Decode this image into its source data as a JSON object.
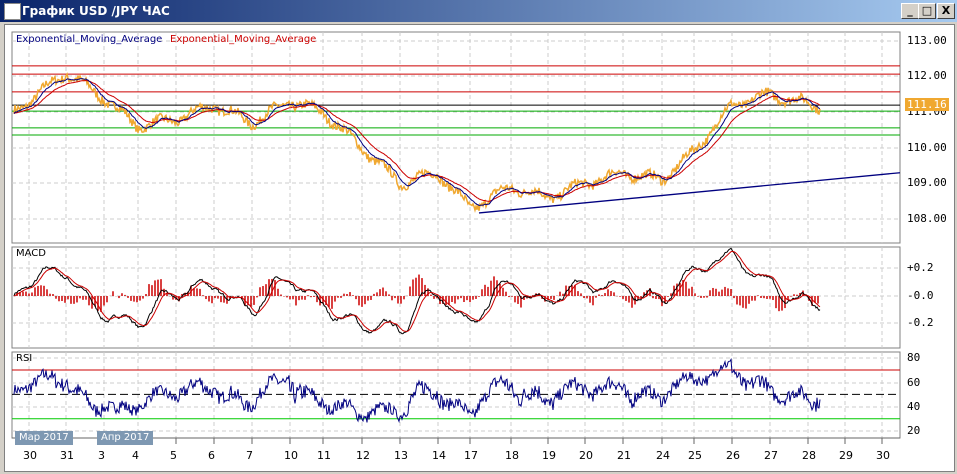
{
  "window": {
    "title": "График USD /JPY  ЧАС",
    "min": "_",
    "max": "□",
    "close": "X"
  },
  "main": {
    "legend": [
      "Exponential_Moving_Average",
      "Exponential_Moving_Average"
    ],
    "axis": [
      "113.00",
      "112.00",
      "111.00",
      "110.00",
      "109.00",
      "108.00"
    ],
    "last_price": "111.16"
  },
  "macd": {
    "label": "MACD",
    "axis": [
      "+0.2",
      "-0.0",
      "-0.2"
    ]
  },
  "rsi": {
    "label": "RSI",
    "axis": [
      "80",
      "60",
      "40",
      "20"
    ]
  },
  "months": [
    "Мар 2017",
    "Апр 2017"
  ],
  "dates": [
    "30",
    "31",
    "3",
    "4",
    "5",
    "6",
    "7",
    "10",
    "11",
    "12",
    "13",
    "14",
    "17",
    "18",
    "19",
    "20",
    "21",
    "24",
    "25",
    "26",
    "27",
    "28",
    "29",
    "30"
  ],
  "colors": {
    "price": "#f0a830",
    "ema_fast": "#000080",
    "ema_slow": "#cc0000",
    "resistance": "#cc0000",
    "support": "#00aa00",
    "trend": "#000080"
  },
  "chart_data": {
    "type": "line",
    "title": "USD/JPY H1",
    "price_keypoints": [
      111.0,
      112.1,
      111.4,
      110.6,
      110.8,
      111.2,
      110.7,
      111.3,
      111.0,
      110.0,
      109.0,
      109.3,
      108.3,
      108.9,
      108.6,
      109.0,
      109.3,
      109.1,
      109.9,
      111.2,
      111.5,
      111.16
    ],
    "hlines_red": [
      112.3,
      112.07,
      111.57
    ],
    "hline_black": 111.2,
    "hlines_green": [
      111.03,
      110.56,
      110.36
    ],
    "trendline": {
      "from": 108.17,
      "to": 109.3
    },
    "ylim": [
      107.7,
      113.25
    ],
    "macd_range": [
      -0.3,
      0.3
    ],
    "rsi_levels": [
      70,
      50,
      30
    ]
  }
}
